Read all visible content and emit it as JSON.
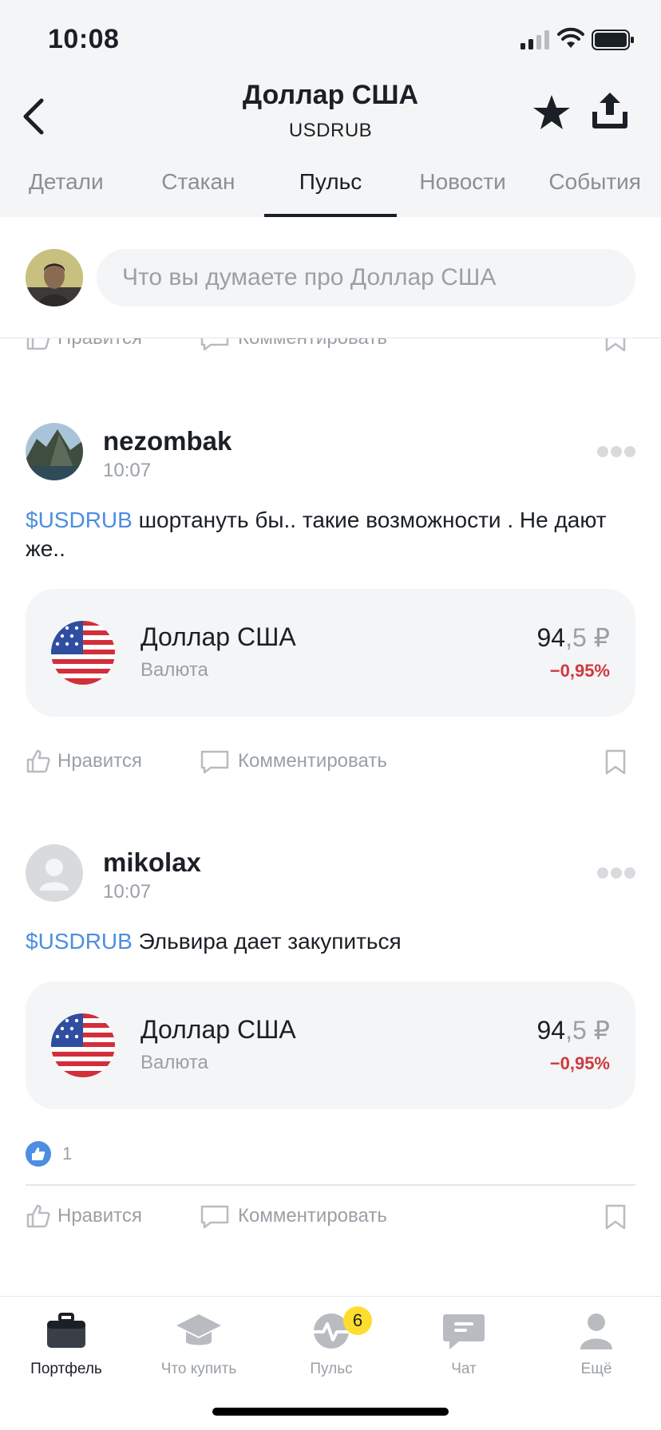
{
  "status_bar": {
    "time": "10:08"
  },
  "header": {
    "title": "Доллар США",
    "subtitle": "USDRUB",
    "tabs": [
      {
        "label": "Детали",
        "active": false
      },
      {
        "label": "Стакан",
        "active": false
      },
      {
        "label": "Пульс",
        "active": true
      },
      {
        "label": "Новости",
        "active": false
      },
      {
        "label": "События",
        "active": false
      }
    ]
  },
  "composer": {
    "placeholder": "Что вы думаете про Доллар США"
  },
  "actions": {
    "like": "Нравится",
    "comment": "Комментировать"
  },
  "posts": [
    {
      "author": "nezombak",
      "time": "10:07",
      "ticker": "$USDRUB",
      "text": " шортануть бы.. такие возможности . Не дают же..",
      "instrument": {
        "name": "Доллар США",
        "type": "Валюта",
        "price_main": "94",
        "price_frac": ",5 ₽",
        "change": "−0,95%"
      }
    },
    {
      "author": "mikolax",
      "time": "10:07",
      "ticker": "$USDRUB",
      "text": " Эльвира дает закупиться",
      "instrument": {
        "name": "Доллар США",
        "type": "Валюта",
        "price_main": "94",
        "price_frac": ",5 ₽",
        "change": "−0,95%"
      },
      "likes": "1"
    }
  ],
  "tab_bar": {
    "items": [
      {
        "label": "Портфель",
        "icon": "briefcase-icon",
        "active": true
      },
      {
        "label": "Что купить",
        "icon": "graduation-cap-icon",
        "active": false
      },
      {
        "label": "Пульс",
        "icon": "pulse-icon",
        "active": false,
        "badge": "6"
      },
      {
        "label": "Чат",
        "icon": "chat-icon",
        "active": false
      },
      {
        "label": "Ещё",
        "icon": "profile-icon",
        "active": false
      }
    ]
  },
  "colors": {
    "accent_link": "#4d8ee0",
    "negative": "#d0383e",
    "badge": "#ffdd2d",
    "header_bg": "#f4f5f6"
  }
}
